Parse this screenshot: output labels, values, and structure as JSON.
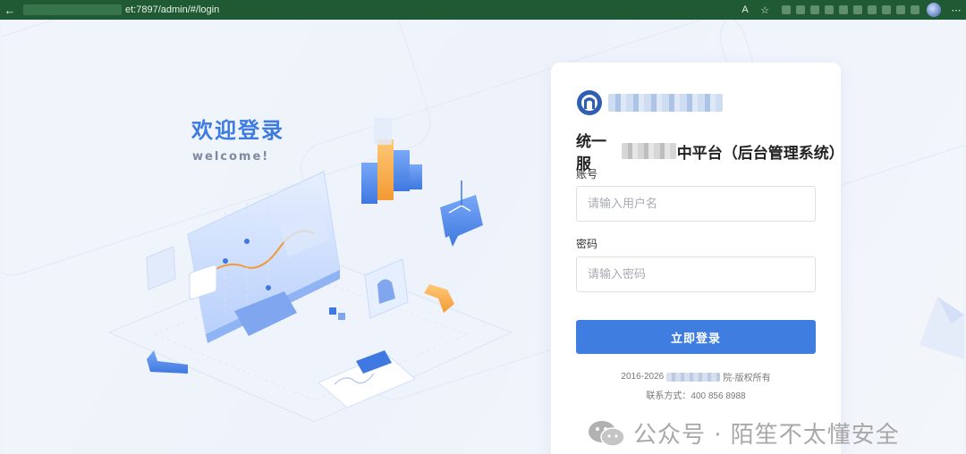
{
  "browser": {
    "url": "et:7897/admin/#/login",
    "back_glyph": "←",
    "more_glyph": "⋯",
    "read_glyph": "A",
    "fav_glyph": "☆"
  },
  "welcome": {
    "title": "欢迎登录",
    "subtitle": "welcome!"
  },
  "login": {
    "system_title_part1": "统一服",
    "system_title_part2": "中平台（后台管理系统）",
    "account_label": "账号",
    "account_placeholder": "请输入用户名",
    "password_label": "密码",
    "password_placeholder": "请输入密码",
    "submit_label": "立即登录",
    "copyright_prefix": "2016-2026",
    "copyright_suffix": "院-版权所有",
    "contact": "联系方式：400 856 8988"
  },
  "watermark": {
    "text": "公众号 · 陌笙不太懂安全"
  },
  "colors": {
    "accent": "#3f7ee0",
    "title_blue": "#3d7be2",
    "browser_bar": "#1f5a34"
  }
}
